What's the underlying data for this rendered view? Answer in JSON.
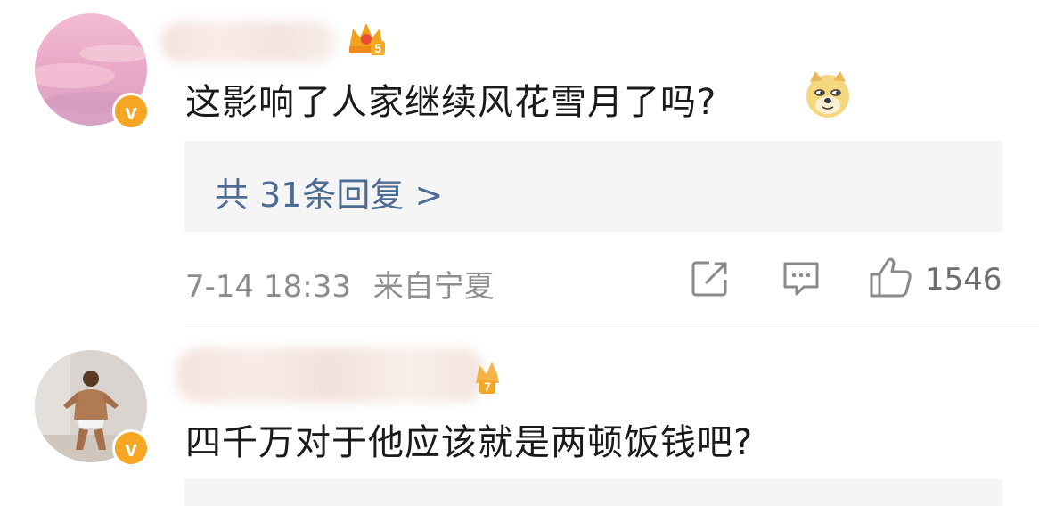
{
  "comments": [
    {
      "verified_badge": "v",
      "crown_level": "5",
      "text": "这影响了人家继续风花雪月了吗?",
      "emoji": "doge-emoji",
      "reply_link": "共 31条回复 >",
      "time": "7-14 18:33",
      "source": "来自宁夏",
      "icons": {
        "repost": "repost-icon",
        "comment": "comment-icon",
        "like": "like-icon"
      },
      "like_count": "1546"
    },
    {
      "verified_badge": "v",
      "crown_level": "7",
      "text": "四千万对于他应该就是两顿饭钱吧?"
    }
  ],
  "colors": {
    "badge": "#f5a623",
    "link": "#4d6c93",
    "meta": "#8d8d8d",
    "reply_bg": "#f5f5f5"
  }
}
